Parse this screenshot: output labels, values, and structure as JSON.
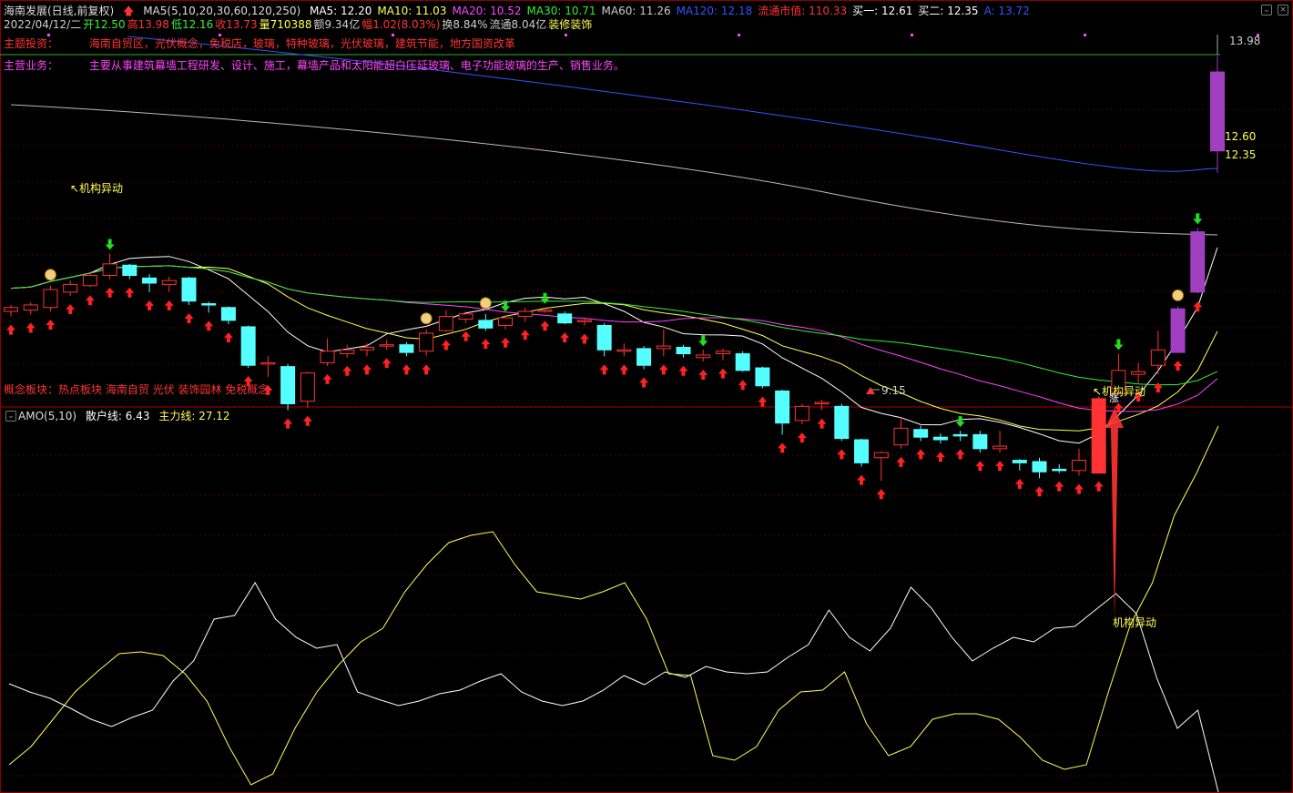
{
  "header": {
    "title": "海南发展(日线,前复权)",
    "ma_label": "MA5(5,10,20,30,60,120,250)",
    "ma": [
      {
        "label": "MA5: 12.20",
        "color": "#ffffff"
      },
      {
        "label": "MA10: 11.03",
        "color": "#ffff55"
      },
      {
        "label": "MA20: 10.52",
        "color": "#ff44ff"
      },
      {
        "label": "MA30: 10.71",
        "color": "#33ee33"
      },
      {
        "label": "MA60: 11.26",
        "color": "#cccccc"
      },
      {
        "label": "MA120: 12.18",
        "color": "#3355ff"
      },
      {
        "label": "流通市值: 110.33",
        "color": "#ff3333"
      },
      {
        "label": "买一: 12.61",
        "color": "#ffffff"
      },
      {
        "label": "买二: 12.35",
        "color": "#ffffff"
      },
      {
        "label": "A: 13.72",
        "color": "#3355ff"
      }
    ],
    "stats": [
      {
        "label": "2022/04/12/二",
        "color": "#cccccc"
      },
      {
        "label": "开12.50",
        "color": "#33ee33"
      },
      {
        "label": "高13.98",
        "color": "#ff3333"
      },
      {
        "label": "低12.16",
        "color": "#33ee33"
      },
      {
        "label": "收13.73",
        "color": "#ff3333"
      },
      {
        "label": "量710388",
        "color": "#ffff55"
      },
      {
        "label": "额9.34亿",
        "color": "#cccccc"
      },
      {
        "label": "幅1.02(8.03%)",
        "color": "#ff3333"
      },
      {
        "label": "换8.84%",
        "color": "#cccccc"
      },
      {
        "label": "流通8.04亿",
        "color": "#cccccc"
      },
      {
        "label": "装修装饰",
        "color": "#ffff55"
      }
    ],
    "theme_label": "主题投资：",
    "theme_text": "海南自贸区，光伏概念，免税店，玻璃，特种玻璃，光伏玻璃，建筑节能，地方国资改革",
    "business_label": "主营业务：",
    "business_text": "主要从事建筑幕墙工程研发、设计、施工，幕墙产品和太阳能超白压延玻璃、电子功能玻璃的生产、销售业务。",
    "concepts": "概念板块：热点板块 海南自贸 光伏 装饰园林 免税概念",
    "concepts_overlay": "量到表示当前"
  },
  "annotations": {
    "inst1": "↖机构异动",
    "inst2": "↖机构异动",
    "inst3": "机构异动",
    "zhang": "涨",
    "high_price": "13.98",
    "low_price": "9.15",
    "price_a": "12.60",
    "price_b": "12.35"
  },
  "indicator": {
    "name": "AMO(5,10)",
    "retail_label": "散户线: 6.43",
    "main_label": "主力线: 27.12",
    "retail_color": "#ffffff",
    "main_color": "#ffff55"
  },
  "colors": {
    "up": "#ff3333",
    "down": "#55ffff",
    "grid": "#8b0000",
    "purple": "#a040c0"
  },
  "chart_data": {
    "type": "candlestick",
    "x_start": "2021-11",
    "x_end": "2022-04-12",
    "ylim": [
      9.0,
      14.2
    ],
    "candles": [
      [
        10.0,
        10.06,
        9.92,
        10.1
      ],
      [
        10.02,
        10.1,
        9.95,
        10.14
      ],
      [
        10.06,
        10.34,
        10.0,
        10.4
      ],
      [
        10.3,
        10.42,
        10.24,
        10.48
      ],
      [
        10.4,
        10.56,
        10.38,
        10.62
      ],
      [
        10.56,
        10.74,
        10.5,
        10.9
      ],
      [
        10.72,
        10.56,
        10.5,
        10.74
      ],
      [
        10.52,
        10.44,
        10.3,
        10.58
      ],
      [
        10.42,
        10.48,
        10.3,
        10.54
      ],
      [
        10.52,
        10.16,
        10.1,
        10.54
      ],
      [
        10.12,
        10.1,
        9.98,
        10.15
      ],
      [
        10.06,
        9.86,
        9.8,
        10.08
      ],
      [
        9.76,
        9.16,
        9.12,
        9.78
      ],
      [
        9.18,
        9.2,
        8.98,
        9.3
      ],
      [
        9.14,
        8.56,
        8.46,
        9.18
      ],
      [
        8.6,
        9.04,
        8.5,
        9.06
      ],
      [
        9.2,
        9.38,
        9.15,
        9.58
      ],
      [
        9.34,
        9.4,
        9.28,
        9.48
      ],
      [
        9.4,
        9.44,
        9.3,
        9.5
      ],
      [
        9.46,
        9.48,
        9.4,
        9.56
      ],
      [
        9.48,
        9.36,
        9.3,
        9.52
      ],
      [
        9.38,
        9.66,
        9.3,
        9.72
      ],
      [
        9.7,
        9.92,
        9.68,
        10.02
      ],
      [
        9.88,
        9.96,
        9.82,
        10.0
      ],
      [
        9.86,
        9.74,
        9.7,
        9.96
      ],
      [
        9.78,
        9.9,
        9.72,
        9.94
      ],
      [
        9.92,
        10.0,
        9.84,
        10.06
      ],
      [
        10.02,
        10.02,
        9.98,
        10.06
      ],
      [
        9.96,
        9.82,
        9.8,
        10.0
      ],
      [
        9.84,
        9.86,
        9.78,
        9.9
      ],
      [
        9.78,
        9.4,
        9.3,
        9.82
      ],
      [
        9.4,
        9.4,
        9.3,
        9.5
      ],
      [
        9.42,
        9.16,
        9.1,
        9.46
      ],
      [
        9.42,
        9.46,
        9.3,
        9.72
      ],
      [
        9.44,
        9.34,
        9.28,
        9.48
      ],
      [
        9.28,
        9.32,
        9.22,
        9.4
      ],
      [
        9.34,
        9.38,
        9.24,
        9.42
      ],
      [
        9.34,
        9.08,
        9.06,
        9.38
      ],
      [
        9.12,
        8.84,
        8.8,
        9.14
      ],
      [
        8.76,
        8.26,
        8.08,
        8.78
      ],
      [
        8.3,
        8.52,
        8.24,
        8.56
      ],
      [
        8.56,
        8.58,
        8.46,
        8.62
      ],
      [
        8.52,
        8.02,
        7.98,
        8.56
      ],
      [
        8.0,
        7.64,
        7.58,
        8.02
      ],
      [
        7.72,
        7.8,
        7.36,
        7.82
      ],
      [
        7.92,
        8.18,
        7.86,
        8.36
      ],
      [
        8.16,
        8.04,
        7.98,
        8.22
      ],
      [
        8.04,
        8.0,
        7.94,
        8.1
      ],
      [
        8.08,
        8.06,
        7.98,
        8.14
      ],
      [
        8.08,
        7.86,
        7.8,
        8.14
      ],
      [
        7.86,
        7.9,
        7.8,
        8.14
      ],
      [
        7.68,
        7.64,
        7.52,
        7.7
      ],
      [
        7.66,
        7.5,
        7.4,
        7.72
      ],
      [
        7.54,
        7.52,
        7.48,
        7.62
      ],
      [
        7.52,
        7.68,
        7.44,
        7.86
      ],
      [
        7.48,
        8.64,
        7.48,
        8.68
      ],
      [
        8.72,
        9.08,
        8.7,
        9.34
      ],
      [
        9.02,
        9.06,
        8.88,
        9.2
      ],
      [
        9.16,
        9.4,
        9.02,
        9.7
      ],
      [
        9.36,
        10.04,
        9.36,
        10.08
      ],
      [
        10.3,
        11.24,
        10.28,
        11.3
      ],
      [
        12.5,
        13.73,
        12.16,
        13.98
      ]
    ],
    "markers_note": "red up-arrows under most candles; green down-arrows above selected candles",
    "amo": {
      "x_index": [
        0,
        1,
        2,
        3,
        4,
        5,
        6,
        7,
        8,
        9,
        10,
        11,
        12,
        13,
        14,
        15,
        16,
        17,
        18,
        19,
        20,
        21,
        22,
        23,
        24,
        25,
        26,
        27,
        28,
        29,
        30,
        31,
        32,
        33,
        34,
        35,
        36,
        37,
        38,
        39,
        40,
        41,
        42,
        43,
        44,
        45,
        46,
        47,
        48,
        49,
        50,
        51,
        52,
        53,
        54,
        55,
        56,
        57,
        58,
        59
      ],
      "retail_y": [
        751,
        760,
        767,
        778,
        790,
        798,
        788,
        780,
        748,
        726,
        680,
        676,
        640,
        680,
        700,
        712,
        708,
        760,
        768,
        775,
        770,
        762,
        758,
        748,
        740,
        760,
        770,
        775,
        770,
        758,
        742,
        752,
        738,
        744,
        732,
        738,
        740,
        738,
        722,
        708,
        670,
        700,
        715,
        690,
        645,
        668,
        700,
        726,
        712,
        700,
        705,
        690,
        688,
        670,
        652,
        674,
        745,
        800,
        780,
        870
      ],
      "main_y": [
        840,
        820,
        790,
        760,
        738,
        718,
        716,
        720,
        740,
        770,
        820,
        862,
        850,
        800,
        760,
        730,
        705,
        690,
        650,
        620,
        596,
        588,
        584,
        620,
        650,
        654,
        658,
        650,
        640,
        680,
        740,
        742,
        830,
        835,
        820,
        780,
        760,
        758,
        738,
        795,
        830,
        820,
        790,
        784,
        784,
        790,
        810,
        835,
        845,
        840,
        760,
        686,
        640,
        566,
        520,
        468
      ]
    }
  }
}
